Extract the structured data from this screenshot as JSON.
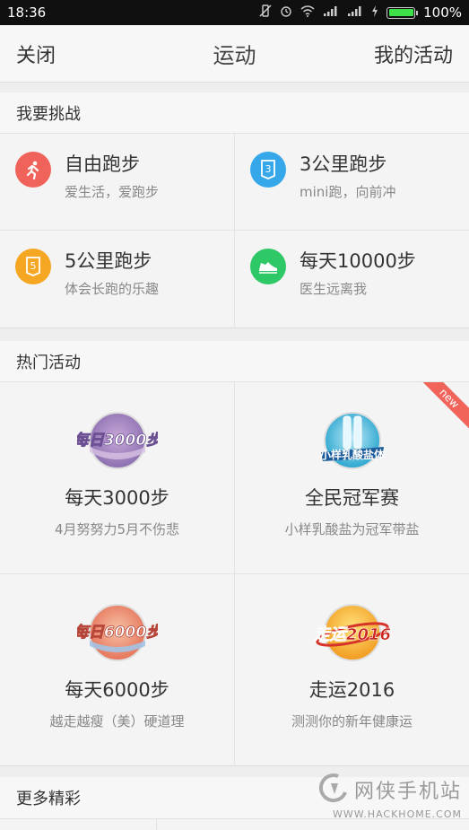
{
  "status_bar": {
    "time": "18:36",
    "battery_pct": "100%",
    "battery_level": 1.0
  },
  "navbar": {
    "close_label": "关闭",
    "title": "运动",
    "my_activities_label": "我的活动"
  },
  "challenge": {
    "header": "我要挑战",
    "items": [
      {
        "title": "自由跑步",
        "subtitle": "爱生活，爱跑步",
        "icon": "runner-icon",
        "color": "#f0635a"
      },
      {
        "title": "3公里跑步",
        "subtitle": "mini跑，向前冲",
        "icon": "badge-3-icon",
        "color": "#36a8ea",
        "icon_text": "3"
      },
      {
        "title": "5公里跑步",
        "subtitle": "体会长跑的乐趣",
        "icon": "badge-5-icon",
        "color": "#f5a623",
        "icon_text": "5"
      },
      {
        "title": "每天10000步",
        "subtitle": "医生远离我",
        "icon": "shoe-icon",
        "color": "#2fc866"
      }
    ]
  },
  "hot": {
    "header": "热门活动",
    "items": [
      {
        "title": "每天3000步",
        "subtitle": "4月努努力5月不伤悲",
        "badge_text": "每日3000步",
        "icon": "badge-3000-icon"
      },
      {
        "title": "全民冠军赛",
        "subtitle": "小样乳酸盐为冠军带盐",
        "badge_text": "小样乳酸盐体",
        "icon": "bottles-badge-icon",
        "ribbon": "new"
      },
      {
        "title": "每天6000步",
        "subtitle": "越走越瘦（美）硬道理",
        "badge_text": "每日6000步",
        "icon": "badge-6000-icon"
      },
      {
        "title": "走运2016",
        "subtitle": "测测你的新年健康运",
        "badge_text": "走运2016",
        "icon": "badge-2016-icon"
      }
    ]
  },
  "more": {
    "header": "更多精彩"
  },
  "watermark": {
    "text": "网侠手机站",
    "url": "WWW.HACKHOME.COM"
  }
}
